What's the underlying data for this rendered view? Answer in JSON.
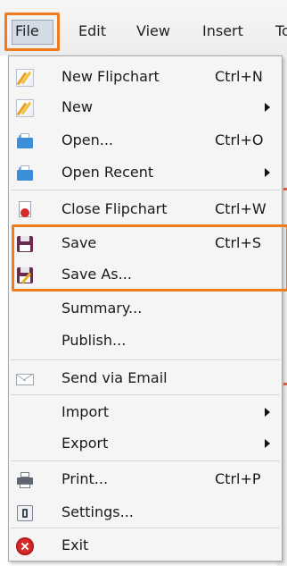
{
  "menubar": {
    "items": [
      "File",
      "Edit",
      "View",
      "Insert",
      "To"
    ]
  },
  "file_menu": {
    "items": [
      {
        "label": "New Flipchart",
        "shortcut": "Ctrl+N",
        "icon": "flipchart-icon"
      },
      {
        "label": "New",
        "shortcut": "",
        "icon": "flipchart-icon",
        "submenu": true
      },
      {
        "label": "Open...",
        "shortcut": "Ctrl+O",
        "icon": "folder-icon"
      },
      {
        "label": "Open Recent",
        "shortcut": "",
        "icon": "folder-icon",
        "submenu": true
      },
      {
        "label": "Close Flipchart",
        "shortcut": "Ctrl+W",
        "icon": "close-document-icon"
      },
      {
        "label": "Save",
        "shortcut": "Ctrl+S",
        "icon": "floppy-disk-icon"
      },
      {
        "label": "Save As...",
        "shortcut": "",
        "icon": "floppy-disk-pencil-icon"
      },
      {
        "label": "Summary...",
        "shortcut": "",
        "icon": ""
      },
      {
        "label": "Publish...",
        "shortcut": "",
        "icon": ""
      },
      {
        "label": "Send via Email",
        "shortcut": "",
        "icon": "envelope-icon"
      },
      {
        "label": "Import",
        "shortcut": "",
        "icon": "",
        "submenu": true
      },
      {
        "label": "Export",
        "shortcut": "",
        "icon": "",
        "submenu": true
      },
      {
        "label": "Print...",
        "shortcut": "Ctrl+P",
        "icon": "printer-icon"
      },
      {
        "label": "Settings...",
        "shortcut": "",
        "icon": "settings-icon"
      },
      {
        "label": "Exit",
        "shortcut": "",
        "icon": "exit-icon"
      }
    ]
  },
  "colors": {
    "highlight": "#ef7b1f",
    "menu_background": "#f5f5f5"
  }
}
